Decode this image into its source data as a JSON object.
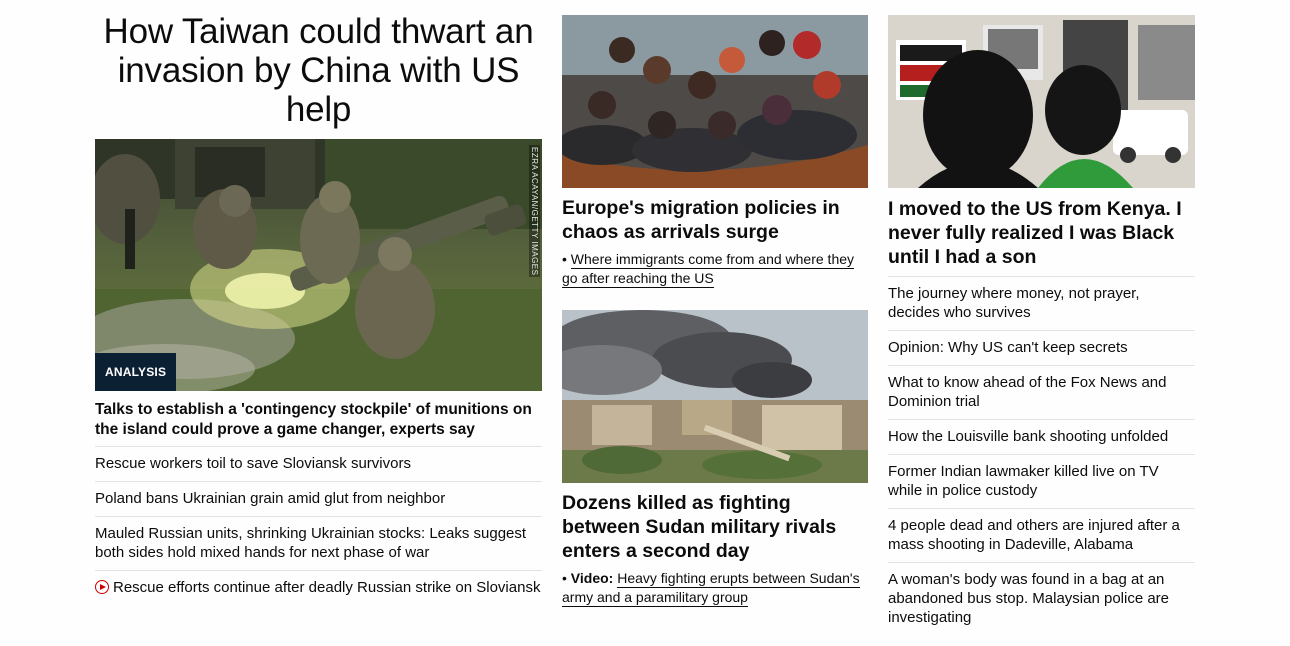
{
  "main_story": {
    "headline": "How Taiwan could thwart an invasion by China with US help",
    "image_credit": "EZRA ACAYAN/GETTY IMAGES",
    "badge": "ANALYSIS",
    "subheadline": "Talks to establish a 'contingency stockpile' of munitions on the island could prove a game changer, experts say",
    "links": [
      "Rescue workers toil to save Sloviansk survivors",
      "Poland bans Ukrainian grain amid glut from neighbor",
      "Mauled Russian units, shrinking Ukrainian stocks: Leaks suggest both sides hold mixed hands for next phase of war",
      "Rescue efforts continue after deadly Russian strike on Sloviansk"
    ]
  },
  "middle": {
    "card1": {
      "title": "Europe's migration policies in chaos as arrivals surge",
      "bullet": "•",
      "link": "Where immigrants come from and where they go after reaching the US"
    },
    "card2": {
      "title": "Dozens killed as fighting between Sudan military rivals enters a second day",
      "bullet": "•",
      "video_label": "Video:",
      "link": "Heavy fighting erupts between Sudan's army and a paramilitary group"
    }
  },
  "right": {
    "title": "I moved to the US from Kenya. I never fully realized I was Black until I had a son",
    "links": [
      "The journey where money, not prayer, decides who survives",
      "Opinion: Why US can't keep secrets",
      "What to know ahead of the Fox News and Dominion trial",
      "How the Louisville bank shooting unfolded",
      "Former Indian lawmaker killed live on TV while in police custody",
      "4 people dead and others are injured after a mass shooting in Dadeville, Alabama",
      "A woman's body was found in a bag at an abandoned bus stop. Malaysian police are investigating"
    ]
  },
  "colors": {
    "badge_bg": "#0c2033",
    "video_icon": "#cc0000",
    "divider": "#e3e3e3"
  }
}
